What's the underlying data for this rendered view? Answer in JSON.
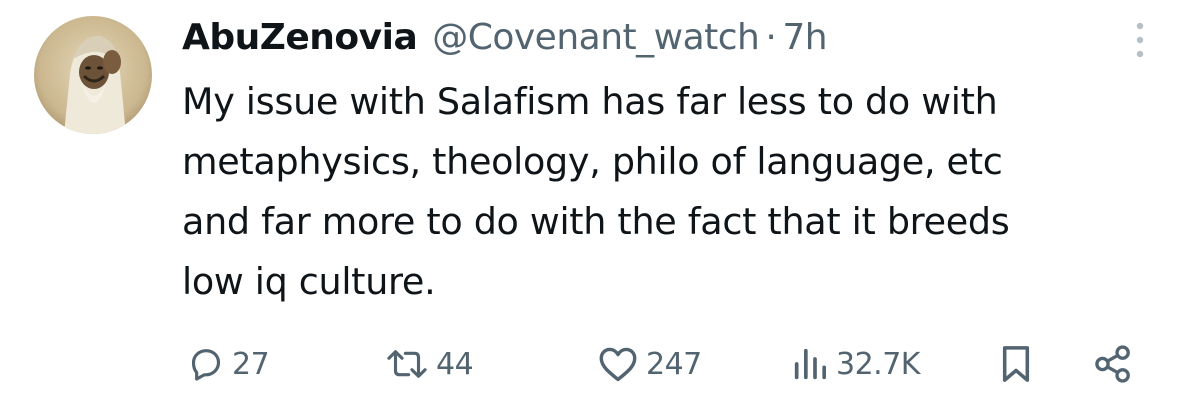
{
  "author": {
    "display_name": "AbuZenovia",
    "handle": "@Covenant_watch",
    "separator": "·",
    "time": "7h"
  },
  "tweet": {
    "lines": [
      "My issue with Salafism has far less to do with",
      "metaphysics, theology, philo of language, etc",
      "and far more to do with the fact that it breeds",
      "low iq culture."
    ]
  },
  "actions": {
    "replies": "27",
    "reposts": "44",
    "likes": "247",
    "views": "32.7K"
  },
  "icons": {
    "more": "more-vertical-icon",
    "reply": "reply-icon",
    "repost": "repost-icon",
    "like": "heart-icon",
    "views": "views-icon",
    "bookmark": "bookmark-icon",
    "share": "share-icon"
  },
  "colors": {
    "text": "#0f1419",
    "secondary": "#536471",
    "background": "#ffffff"
  }
}
